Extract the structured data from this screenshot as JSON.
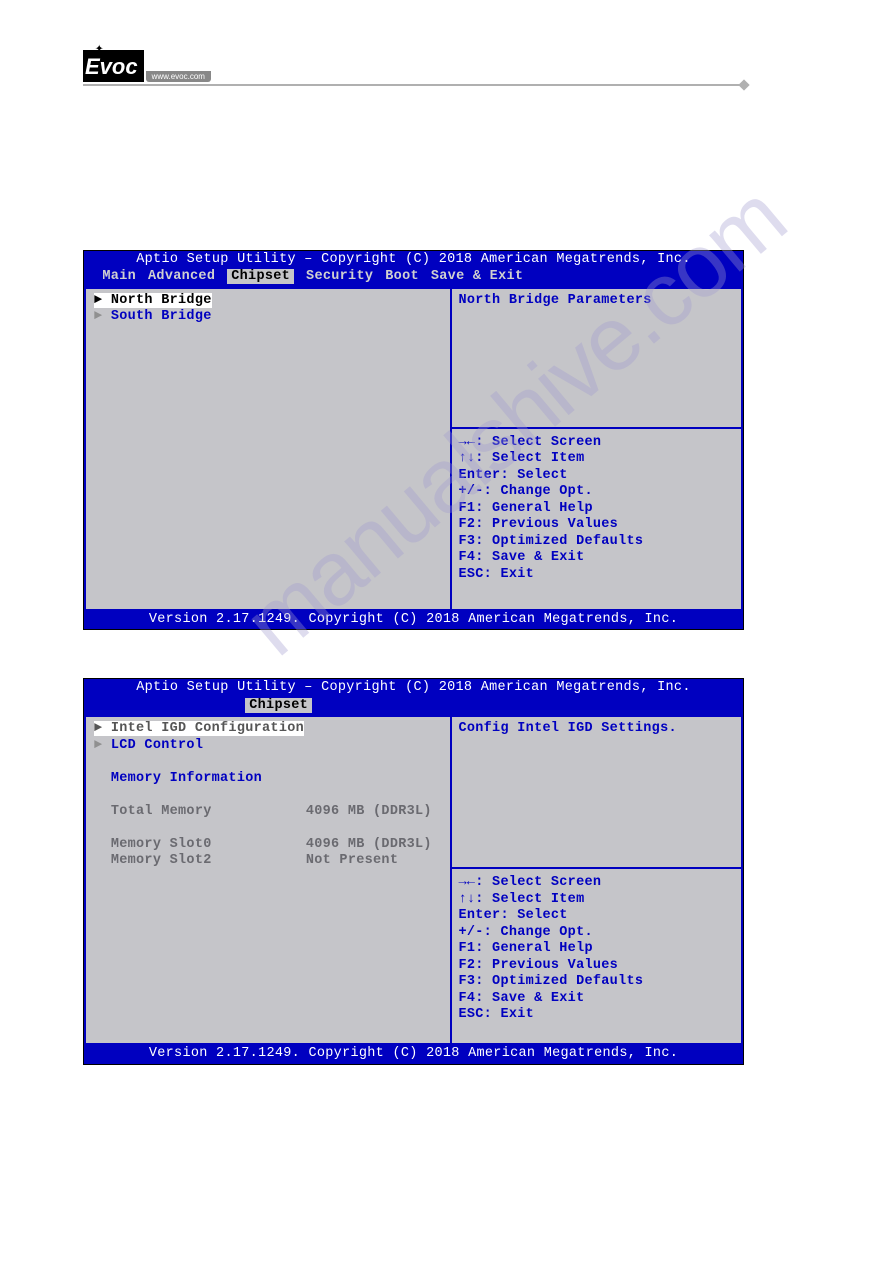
{
  "logo": {
    "text": "Evoc",
    "url": "www.evoc.com"
  },
  "watermark": "manualshive.com",
  "bios1": {
    "title": "Aptio Setup Utility – Copyright (C) 2018 American Megatrends, Inc.",
    "tabs": {
      "main": "Main",
      "advanced": "Advanced",
      "chipset": "Chipset",
      "security": "Security",
      "boot": "Boot",
      "save": "Save & Exit"
    },
    "items": {
      "north": "North Bridge",
      "south": "South Bridge"
    },
    "help_title": "North Bridge Parameters",
    "help_keys": {
      "l1": "→←: Select Screen",
      "l2": "↑↓: Select Item",
      "l3": "Enter: Select",
      "l4": "+/-: Change Opt.",
      "l5": "F1: General Help",
      "l6": "F2: Previous Values",
      "l7": "F3: Optimized Defaults",
      "l8": "F4: Save & Exit",
      "l9": "ESC: Exit"
    },
    "footer": "Version 2.17.1249. Copyright (C) 2018 American Megatrends, Inc."
  },
  "bios2": {
    "title": "Aptio Setup Utility – Copyright (C) 2018 American Megatrends, Inc.",
    "tabs": {
      "chipset": "Chipset"
    },
    "items": {
      "igd": "Intel IGD Configuration",
      "lcd": "LCD Control"
    },
    "section": "Memory Information",
    "rows": {
      "total": {
        "label": "Total Memory",
        "value": "4096 MB (DDR3L)"
      },
      "slot0": {
        "label": "Memory Slot0",
        "value": "4096 MB (DDR3L)"
      },
      "slot2": {
        "label": "Memory Slot2",
        "value": "Not Present"
      }
    },
    "help_title": "Config Intel IGD Settings.",
    "help_keys": {
      "l1": "→←: Select Screen",
      "l2": "↑↓: Select Item",
      "l3": "Enter: Select",
      "l4": "+/-: Change Opt.",
      "l5": "F1: General Help",
      "l6": "F2: Previous Values",
      "l7": "F3: Optimized Defaults",
      "l8": "F4: Save & Exit",
      "l9": "ESC: Exit"
    },
    "footer": "Version 2.17.1249. Copyright (C) 2018 American Megatrends, Inc."
  }
}
